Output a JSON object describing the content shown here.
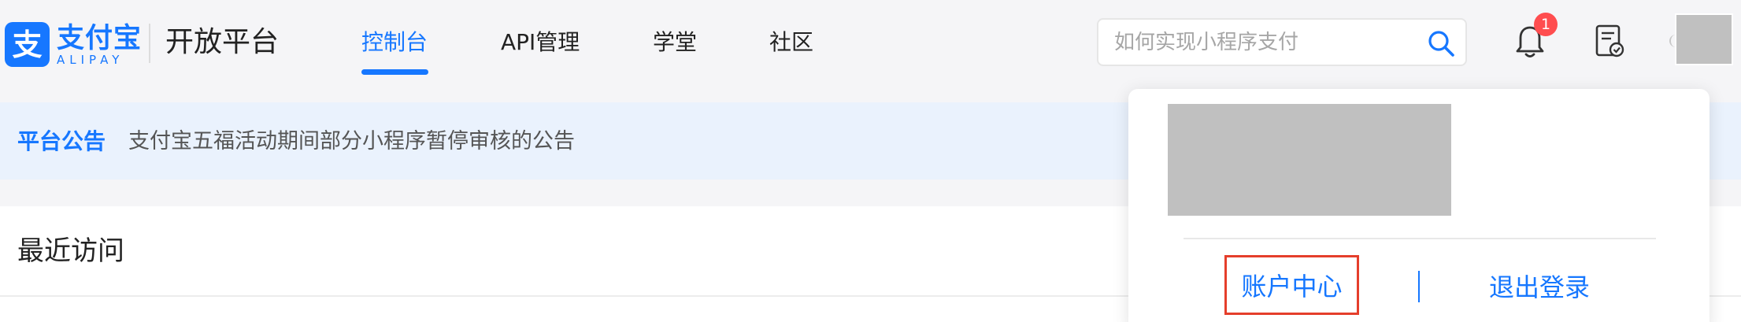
{
  "header": {
    "logo": {
      "cn": "支付宝",
      "en": "ALIPAY",
      "mark": "支"
    },
    "platform_name": "开放平台",
    "nav": [
      {
        "label": "控制台",
        "active": true
      },
      {
        "label": "API管理",
        "active": false
      },
      {
        "label": "学堂",
        "active": false
      },
      {
        "label": "社区",
        "active": false
      }
    ],
    "search": {
      "placeholder": "如何实现小程序支付",
      "value": ""
    },
    "notifications": {
      "count": "1",
      "icon": "bell-icon"
    },
    "todo_icon": "document-check-icon",
    "avatar": "avatar"
  },
  "notice": {
    "title": "平台公告",
    "text": "支付宝五福活动期间部分小程序暂停审核的公告"
  },
  "recent": {
    "title": "最近访问"
  },
  "dropdown": {
    "account_center": "账户中心",
    "logout": "退出登录"
  },
  "colors": {
    "accent": "#1677ff",
    "badge": "#ff4d4f",
    "notice_bg": "#eaf2fd",
    "highlight_border": "#e53e2b"
  }
}
